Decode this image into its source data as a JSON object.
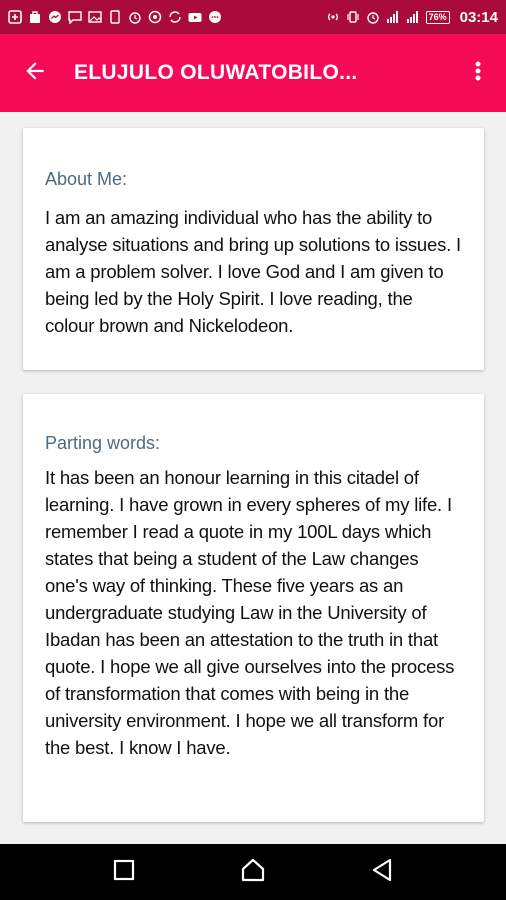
{
  "status_bar": {
    "time": "03:14",
    "battery": "76%",
    "icons": [
      "add-box-icon",
      "bag-icon",
      "messenger-icon",
      "chat-icon",
      "image-icon",
      "phone-icon",
      "alarm-icon",
      "whatsapp-icon",
      "sync-icon",
      "youtube-icon",
      "sms-icon",
      "hotspot-icon",
      "vibrate-icon",
      "alarm-icon",
      "signal-icon",
      "battery-icon"
    ]
  },
  "app_bar": {
    "title": "ELUJULO OLUWATOBILO...",
    "back_icon": "arrow-back-icon",
    "menu_icon": "more-vert-icon"
  },
  "about": {
    "heading": "About Me:",
    "body": "I am an amazing individual who has the ability to analyse situations and bring up solutions to issues. I am a problem solver. I love God and I am given to being led by the Holy Spirit. I love reading, the colour brown and Nickelodeon."
  },
  "parting": {
    "heading": "Parting words:",
    "body": "It has been an honour learning in this citadel of learning. I have grown in every spheres of my life. I remember I read a quote in my 100L days which states that being a student of the Law changes one's way of thinking. These five years as an undergraduate studying Law in the University of Ibadan has been an attestation to the truth in that quote. I hope we all give ourselves into the process of transformation that comes with being in the university environment. I hope we all transform for the best. I know I have."
  },
  "nav_bar": {
    "recents_icon": "recents-square-icon",
    "home_icon": "home-icon",
    "back_icon": "back-triangle-icon"
  },
  "colors": {
    "status_bar": "#aa0a3c",
    "app_bar": "#f50a58",
    "heading": "#4f6a80"
  }
}
